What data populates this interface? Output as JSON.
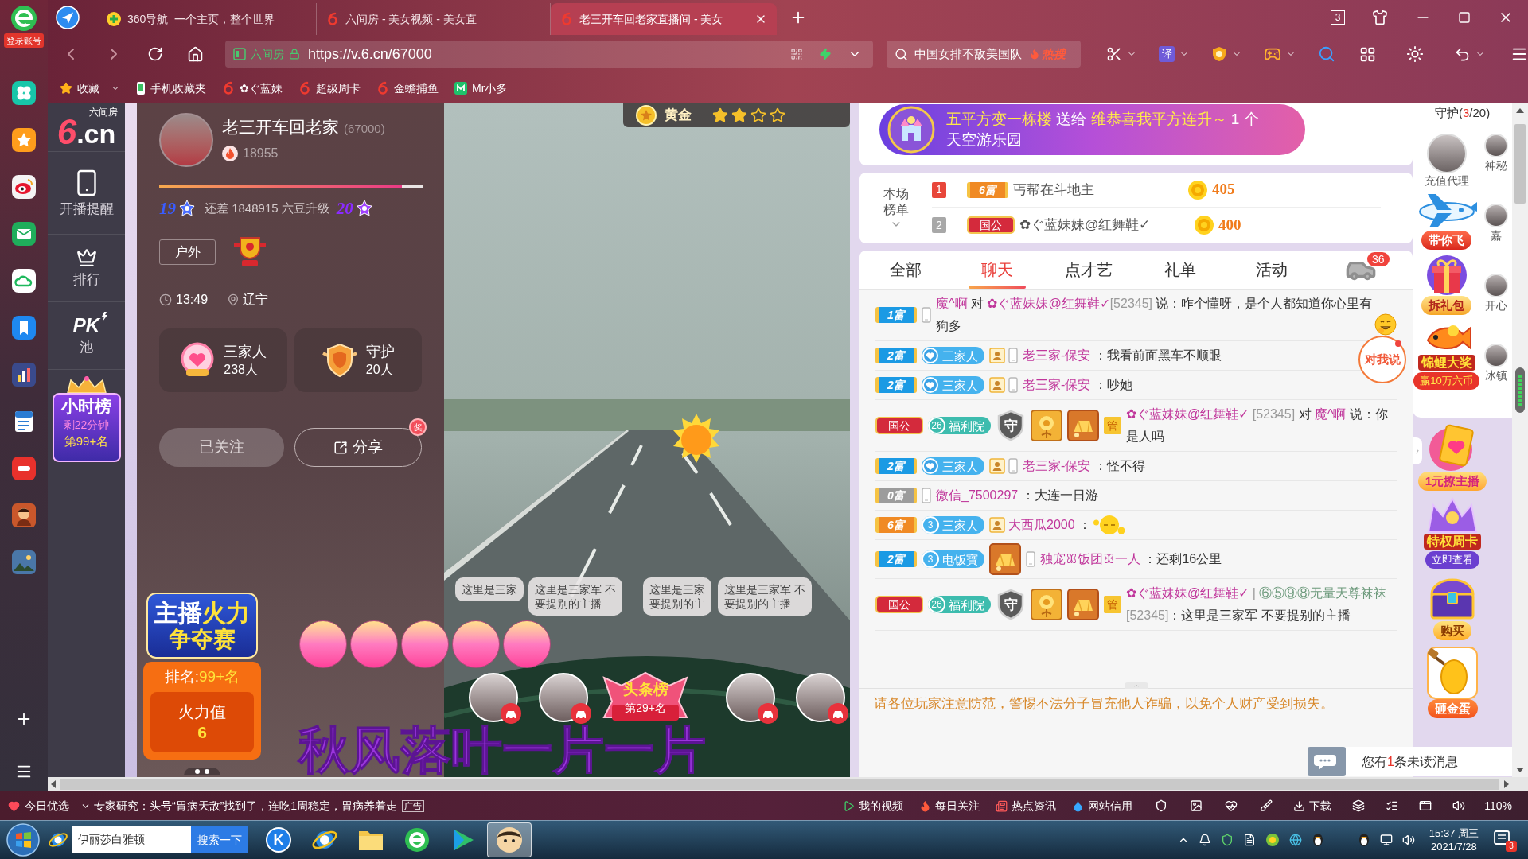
{
  "browser": {
    "account_label": "登录账号",
    "tabs": [
      {
        "title": "360导航_一个主页，整个世界",
        "kind": "portal",
        "selected": false
      },
      {
        "title": "六间房 - 美女视频 - 美女直",
        "kind": "six",
        "selected": false
      },
      {
        "title": "老三开车回老家直播间 - 美女",
        "kind": "six",
        "selected": true
      }
    ],
    "tab_count": "3",
    "address": {
      "site": "六间房",
      "url": "https://v.6.cn/67000"
    },
    "search": {
      "value": "中国女排不敌美国队",
      "badge": "热搜"
    },
    "translate": "译",
    "bookmarks": [
      {
        "label": "收藏",
        "kind": "star"
      },
      {
        "label": "手机收藏夹",
        "kind": "phone"
      },
      {
        "label": "✿ぐ蓝妹",
        "kind": "six"
      },
      {
        "label": "超级周卡",
        "kind": "six"
      },
      {
        "label": "金蟾捕鱼",
        "kind": "six"
      },
      {
        "label": "Mr小多",
        "kind": "app"
      }
    ]
  },
  "nav": {
    "logo": {
      "caption": "六间房",
      "mark": "6",
      "domain": ".cn"
    },
    "items": [
      {
        "label": "开播提醒",
        "kind": "phone"
      },
      {
        "label": "排行",
        "kind": "crown"
      },
      {
        "tag": "PK",
        "label": "池",
        "kind": "pk"
      }
    ],
    "hour_rank": {
      "title": "小时榜",
      "remaining": "剩22分钟",
      "rank": "第99+名"
    }
  },
  "anchor": {
    "name": "老三开车回老家",
    "room": "(67000)",
    "heat": "18955",
    "level": 0.92,
    "level_from": "19",
    "upgrade_note": "还差 1848915 六豆升级",
    "level_to": "20",
    "tag": "户外",
    "time": "13:49",
    "location": "辽宁",
    "stats": [
      {
        "title": "三家人",
        "count": "238人",
        "kind": "fans"
      },
      {
        "title": "守护",
        "count": "20人",
        "kind": "guard"
      }
    ],
    "buttons": [
      {
        "label": "已关注",
        "kind": "followed"
      },
      {
        "label": "分享",
        "kind": "share",
        "badge": "奖"
      }
    ]
  },
  "fire_contest": {
    "title_a": "主播",
    "title_b": "火力",
    "title_c": "争夺赛",
    "rank_label": "排名:",
    "rank_value": "99+名",
    "power_label": "火力值",
    "power_value": "6"
  },
  "video": {
    "medal": "黄金",
    "stars": 2,
    "bubbles": [
      {
        "lines": [
          "这里是三家"
        ]
      },
      {
        "lines": [
          "这里是三家军 不",
          "要提别的主播"
        ]
      },
      {
        "lines": [
          "这里是三家",
          "要提别的主"
        ]
      },
      {
        "lines": [
          "这里是三家军 不",
          "要提别的主播"
        ]
      }
    ],
    "headline": {
      "title": "头条榜",
      "rank": "第29+名"
    },
    "caption": "秋风落叶一片一片"
  },
  "chat": {
    "banner": [
      {
        "text": "五平方变一栋楼",
        "kind": "highlight"
      },
      {
        "text": " 送给 ",
        "kind": "plain"
      },
      {
        "text": "维恭喜我平方连升～",
        "kind": "highlight"
      },
      {
        "text": " 1 个天空游乐园",
        "kind": "plain"
      }
    ],
    "ranking": {
      "title": "本场榜单",
      "rows": [
        {
          "rank": "1",
          "color": "#e8463a",
          "badge": {
            "kind": "wealth",
            "label": "6富",
            "color": "#f08a24"
          },
          "name": "丐帮在斗地主",
          "score": "405"
        },
        {
          "rank": "2",
          "color": "#a8a8a8",
          "badge": {
            "kind": "duke",
            "label": "国公"
          },
          "name": "✿ぐ蓝妹妹@红舞鞋✓",
          "score": "400"
        }
      ]
    },
    "tabs": [
      {
        "label": "全部",
        "selected": false
      },
      {
        "label": "聊天",
        "selected": true
      },
      {
        "label": "点才艺",
        "selected": false
      },
      {
        "label": "礼单",
        "selected": false
      },
      {
        "label": "活动",
        "selected": false
      }
    ],
    "car_count": "36",
    "messages": [
      {
        "badges": [
          {
            "kind": "wealth",
            "label": "1富",
            "color": "#1b9ae4"
          },
          {
            "kind": "phone"
          }
        ],
        "parts": [
          {
            "kind": "name",
            "text": "魔^啊"
          },
          {
            "kind": "text",
            "text": " 对 "
          },
          {
            "kind": "name",
            "text": "✿ぐ蓝妹妹@红舞鞋✓"
          },
          {
            "kind": "muted",
            "text": "[52345]"
          },
          {
            "kind": "text",
            "text": " 说：咋个懂呀，是个人都知道你心里有狗多"
          }
        ],
        "emoji": {
          "kind": "grin"
        }
      },
      {
        "badges": [
          {
            "kind": "wealth",
            "label": "2富",
            "color": "#1b9ae4"
          },
          {
            "kind": "fan",
            "label": "三家人",
            "color": "#45b2ee"
          },
          {
            "kind": "user"
          },
          {
            "kind": "phone"
          }
        ],
        "parts": [
          {
            "kind": "name",
            "text": "老三家-保安"
          },
          {
            "kind": "text",
            "text": " ：我看前面黑车不顺眼"
          }
        ]
      },
      {
        "badges": [
          {
            "kind": "wealth",
            "label": "2富",
            "color": "#1b9ae4"
          },
          {
            "kind": "fan",
            "label": "三家人",
            "color": "#45b2ee"
          },
          {
            "kind": "user"
          },
          {
            "kind": "phone"
          }
        ],
        "parts": [
          {
            "kind": "name",
            "text": "老三家-保安"
          },
          {
            "kind": "text",
            "text": " ：吵她"
          }
        ]
      },
      {
        "badges": [
          {
            "kind": "duke",
            "label": "国公"
          },
          {
            "kind": "fan",
            "label": "福利院",
            "number": "26",
            "color": "#3dbcae"
          },
          {
            "kind": "guard",
            "label": "守"
          },
          {
            "kind": "rose"
          },
          {
            "kind": "ingot"
          },
          {
            "kind": "admin",
            "label": "管"
          }
        ],
        "parts": [
          {
            "kind": "name",
            "text": "✿ぐ蓝妹妹@红舞鞋✓"
          },
          {
            "kind": "muted",
            "text": " [52345] "
          },
          {
            "kind": "text",
            "text": "对 "
          },
          {
            "kind": "name",
            "text": "魔^啊"
          },
          {
            "kind": "text",
            "text": " 说：你是人吗"
          }
        ]
      },
      {
        "badges": [
          {
            "kind": "wealth",
            "label": "2富",
            "color": "#1b9ae4"
          },
          {
            "kind": "fan",
            "label": "三家人",
            "color": "#45b2ee"
          },
          {
            "kind": "user"
          },
          {
            "kind": "phone"
          }
        ],
        "parts": [
          {
            "kind": "name",
            "text": "老三家-保安"
          },
          {
            "kind": "text",
            "text": " ：怪不得"
          }
        ]
      },
      {
        "badges": [
          {
            "kind": "wealth",
            "label": "0富",
            "color": "#9c9c9c"
          },
          {
            "kind": "phone"
          }
        ],
        "parts": [
          {
            "kind": "name",
            "text": "微信_7500297"
          },
          {
            "kind": "text",
            "text": " ：大连一日游"
          }
        ]
      },
      {
        "badges": [
          {
            "kind": "wealth",
            "label": "6富",
            "color": "#f08a24"
          },
          {
            "kind": "fan",
            "label": "三家人",
            "number": "3",
            "color": "#45b2ee"
          },
          {
            "kind": "user"
          }
        ],
        "parts": [
          {
            "kind": "name",
            "text": "大西瓜2000"
          },
          {
            "kind": "text",
            "text": " ："
          }
        ],
        "emoji": {
          "kind": "sleepy"
        }
      },
      {
        "badges": [
          {
            "kind": "wealth",
            "label": "2富",
            "color": "#1b9ae4"
          },
          {
            "kind": "fan",
            "label": "电饭寶",
            "number": "3",
            "color": "#45b2ee"
          },
          {
            "kind": "ingot"
          },
          {
            "kind": "phone"
          }
        ],
        "parts": [
          {
            "kind": "name",
            "text": "独宠ꕥ饭团ꕥ一人"
          },
          {
            "kind": "text",
            "text": " ：还剩16公里"
          }
        ]
      },
      {
        "badges": [
          {
            "kind": "duke",
            "label": "国公"
          },
          {
            "kind": "fan",
            "label": "福利院",
            "number": "26",
            "color": "#3dbcae"
          },
          {
            "kind": "guard",
            "label": "守"
          },
          {
            "kind": "rose"
          },
          {
            "kind": "ingot"
          },
          {
            "kind": "admin",
            "label": "管"
          }
        ],
        "parts": [
          {
            "kind": "name",
            "text": "✿ぐ蓝妹妹@红舞鞋✓"
          },
          {
            "kind": "muted",
            "text": " | "
          },
          {
            "kind": "tag",
            "text": "⑥⑤⑨⑧无量天尊袜袜"
          },
          {
            "kind": "muted",
            "text": " [52345]"
          },
          {
            "kind": "text",
            "text": "：这里是三家军 不要提别的主播"
          }
        ]
      }
    ],
    "warning": "请各位玩家注意防范，警惕不法分子冒充他人诈骗，以免个人财产受到损失。",
    "say_to_me": "对我说"
  },
  "side": {
    "guards": {
      "label": "守护(",
      "count": "3",
      "rest": "/20)",
      "main": "充值代理",
      "edge": [
        "神秘",
        "嘉",
        "开心",
        "冰镇"
      ]
    },
    "card_promos": [
      {
        "kind": "plane",
        "label": "带你飞"
      },
      {
        "kind": "gift",
        "label": "拆礼包"
      },
      {
        "kind": "koi",
        "label": "锦鲤大奖",
        "sub": "赢10万六币"
      }
    ],
    "promos": [
      {
        "kind": "heart",
        "label": "1元撩主播"
      },
      {
        "kind": "crest",
        "label": "特权周卡",
        "sub": "立即查看"
      },
      {
        "kind": "chest",
        "label": "购买"
      },
      {
        "kind": "egg",
        "label": "砸金蛋"
      }
    ]
  },
  "unread": {
    "before": "您有",
    "count": "1",
    "after": "条未读消息"
  },
  "status_bar": {
    "pick": "今日优选",
    "ad": "专家研究：头号“胃病天敌”找到了，连吃1周稳定，胃病养着走",
    "ad_tag": "广告",
    "links": [
      {
        "label": "我的视频",
        "kind": "video"
      },
      {
        "label": "每日关注",
        "kind": "fire"
      },
      {
        "label": "热点资讯",
        "kind": "news"
      },
      {
        "label": "网站信用",
        "kind": "drop"
      }
    ],
    "download": "下载",
    "zoom": "110%"
  },
  "taskbar": {
    "search": {
      "value": "伊丽莎白雅顿",
      "button": "搜索一下"
    },
    "apps": [
      {
        "kind": "letter",
        "glyph": "K",
        "selected": false
      },
      {
        "kind": "orbit",
        "selected": false
      },
      {
        "kind": "folder",
        "selected": false
      },
      {
        "kind": "browser",
        "selected": false
      },
      {
        "kind": "player",
        "selected": false
      },
      {
        "kind": "avatar",
        "selected": true
      }
    ],
    "time": "15:37 周三",
    "date": "2021/7/28",
    "notifications": "3"
  }
}
